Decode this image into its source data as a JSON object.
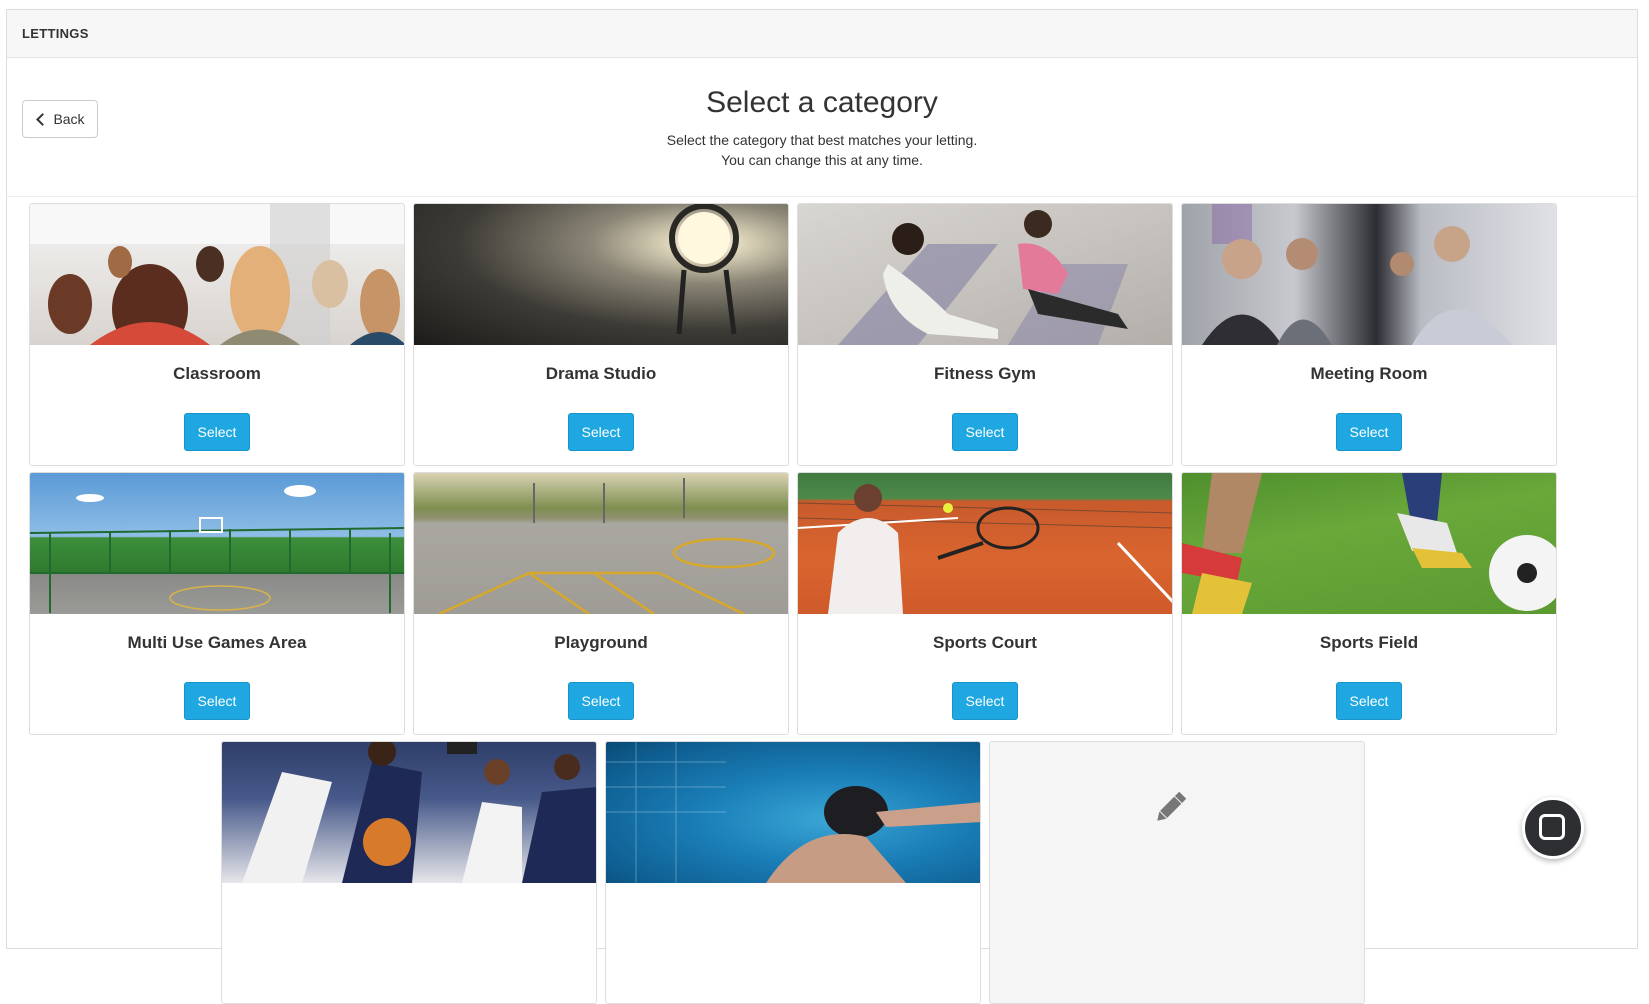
{
  "panel": {
    "header_title": "LETTINGS"
  },
  "top": {
    "back_label": "Back",
    "title": "Select a category",
    "subtitle_line1": "Select the category that best matches your letting.",
    "subtitle_line2": "You can change this at any time."
  },
  "categories": [
    {
      "name": "Classroom",
      "button": "Select",
      "image": "classroom-photo"
    },
    {
      "name": "Drama Studio",
      "button": "Select",
      "image": "drama-studio-photo"
    },
    {
      "name": "Fitness Gym",
      "button": "Select",
      "image": "fitness-gym-photo"
    },
    {
      "name": "Meeting Room",
      "button": "Select",
      "image": "meeting-room-photo"
    },
    {
      "name": "Multi Use Games Area",
      "button": "Select",
      "image": "muga-photo"
    },
    {
      "name": "Playground",
      "button": "Select",
      "image": "playground-photo"
    },
    {
      "name": "Sports Court",
      "button": "Select",
      "image": "sports-court-photo"
    },
    {
      "name": "Sports Field",
      "button": "Select",
      "image": "sports-field-photo"
    },
    {
      "name": "",
      "button": "",
      "image": "sports-hall-photo"
    },
    {
      "name": "",
      "button": "",
      "image": "swimming-pool-photo"
    },
    {
      "name": "",
      "button": "",
      "image": "custom-category",
      "icon": "pencil-icon"
    }
  ],
  "colors": {
    "primary_button": "#1ea7e1",
    "header_bg": "#f7f7f7"
  },
  "chat": {
    "icon": "chat-icon"
  }
}
